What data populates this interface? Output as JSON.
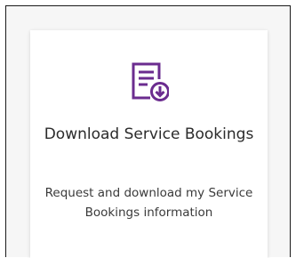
{
  "card": {
    "icon": "document-download-icon",
    "title": "Download Service Bookings",
    "description": "Request and download my Service Bookings information",
    "accent_color": "#6b2c8f"
  }
}
